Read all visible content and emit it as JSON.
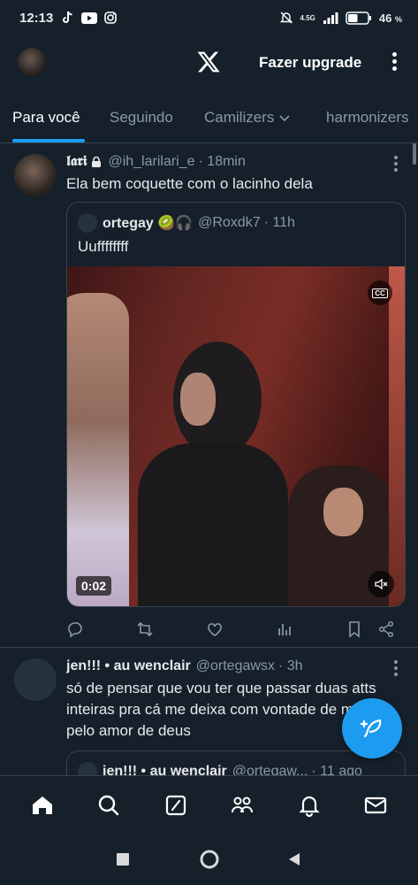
{
  "status": {
    "time": "12:13",
    "network": "4.5G",
    "battery": "46",
    "battery_unit": "%"
  },
  "header": {
    "upgrade_label": "Fazer upgrade"
  },
  "tabs": [
    {
      "label": "Para você",
      "active": true
    },
    {
      "label": "Seguindo",
      "active": false
    },
    {
      "label": "Camilizers",
      "active": false
    },
    {
      "label": "harmonizers",
      "active": false
    }
  ],
  "tweets": [
    {
      "name": "𝖑𝖆𝖗𝖎",
      "handle": "@ih_larilari_e",
      "time": "· 18min",
      "text": "Ela bem coquette com o lacinho dela",
      "quote": {
        "name": "ortegay 🥝🎧",
        "handle": "@Roxdk7",
        "time": "· 11h",
        "text": "Uuffffffff",
        "video_duration": "0:02",
        "cc_label": "CC"
      }
    },
    {
      "name": "jen!!! • au wenclair",
      "handle": "@ortegawsx",
      "time": "· 3h",
      "text": "só de pensar que vou ter que passar duas atts inteiras pra cá me deixa com vontade de morrer pelo amor de deus",
      "quote": {
        "name": "jen!!! • au wenclair",
        "handle": "@ortegaw...",
        "time": "· 11 ago"
      }
    }
  ],
  "colors": {
    "background": "#15202b",
    "accent": "#1d9bf0",
    "muted": "#8b98a5",
    "border": "#38444d"
  }
}
